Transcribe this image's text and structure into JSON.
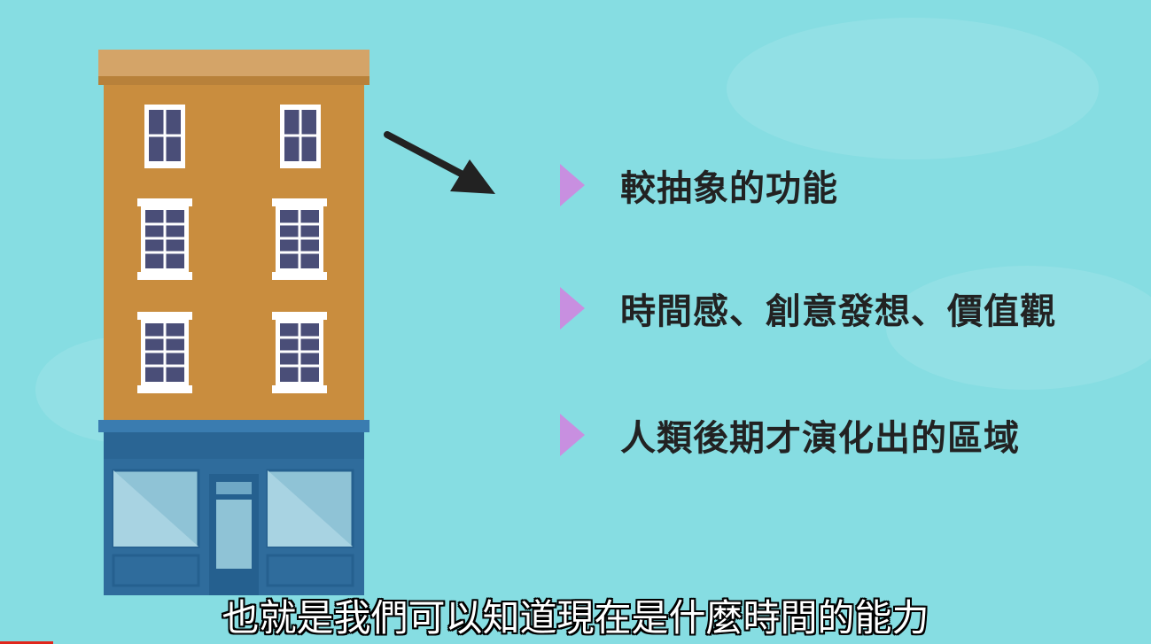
{
  "bullets": [
    {
      "label": "較抽象的功能"
    },
    {
      "label": "時間感、創意發想、價值觀"
    },
    {
      "label": "人類後期才演化出的區域"
    }
  ],
  "caption": "也就是我們可以知道現在是什麼時間的能力",
  "colors": {
    "background": "#86dde2",
    "bullet": "#c88fe0",
    "building": "#c98d3e",
    "storefront": "#2f6c9c",
    "text": "#222222"
  }
}
